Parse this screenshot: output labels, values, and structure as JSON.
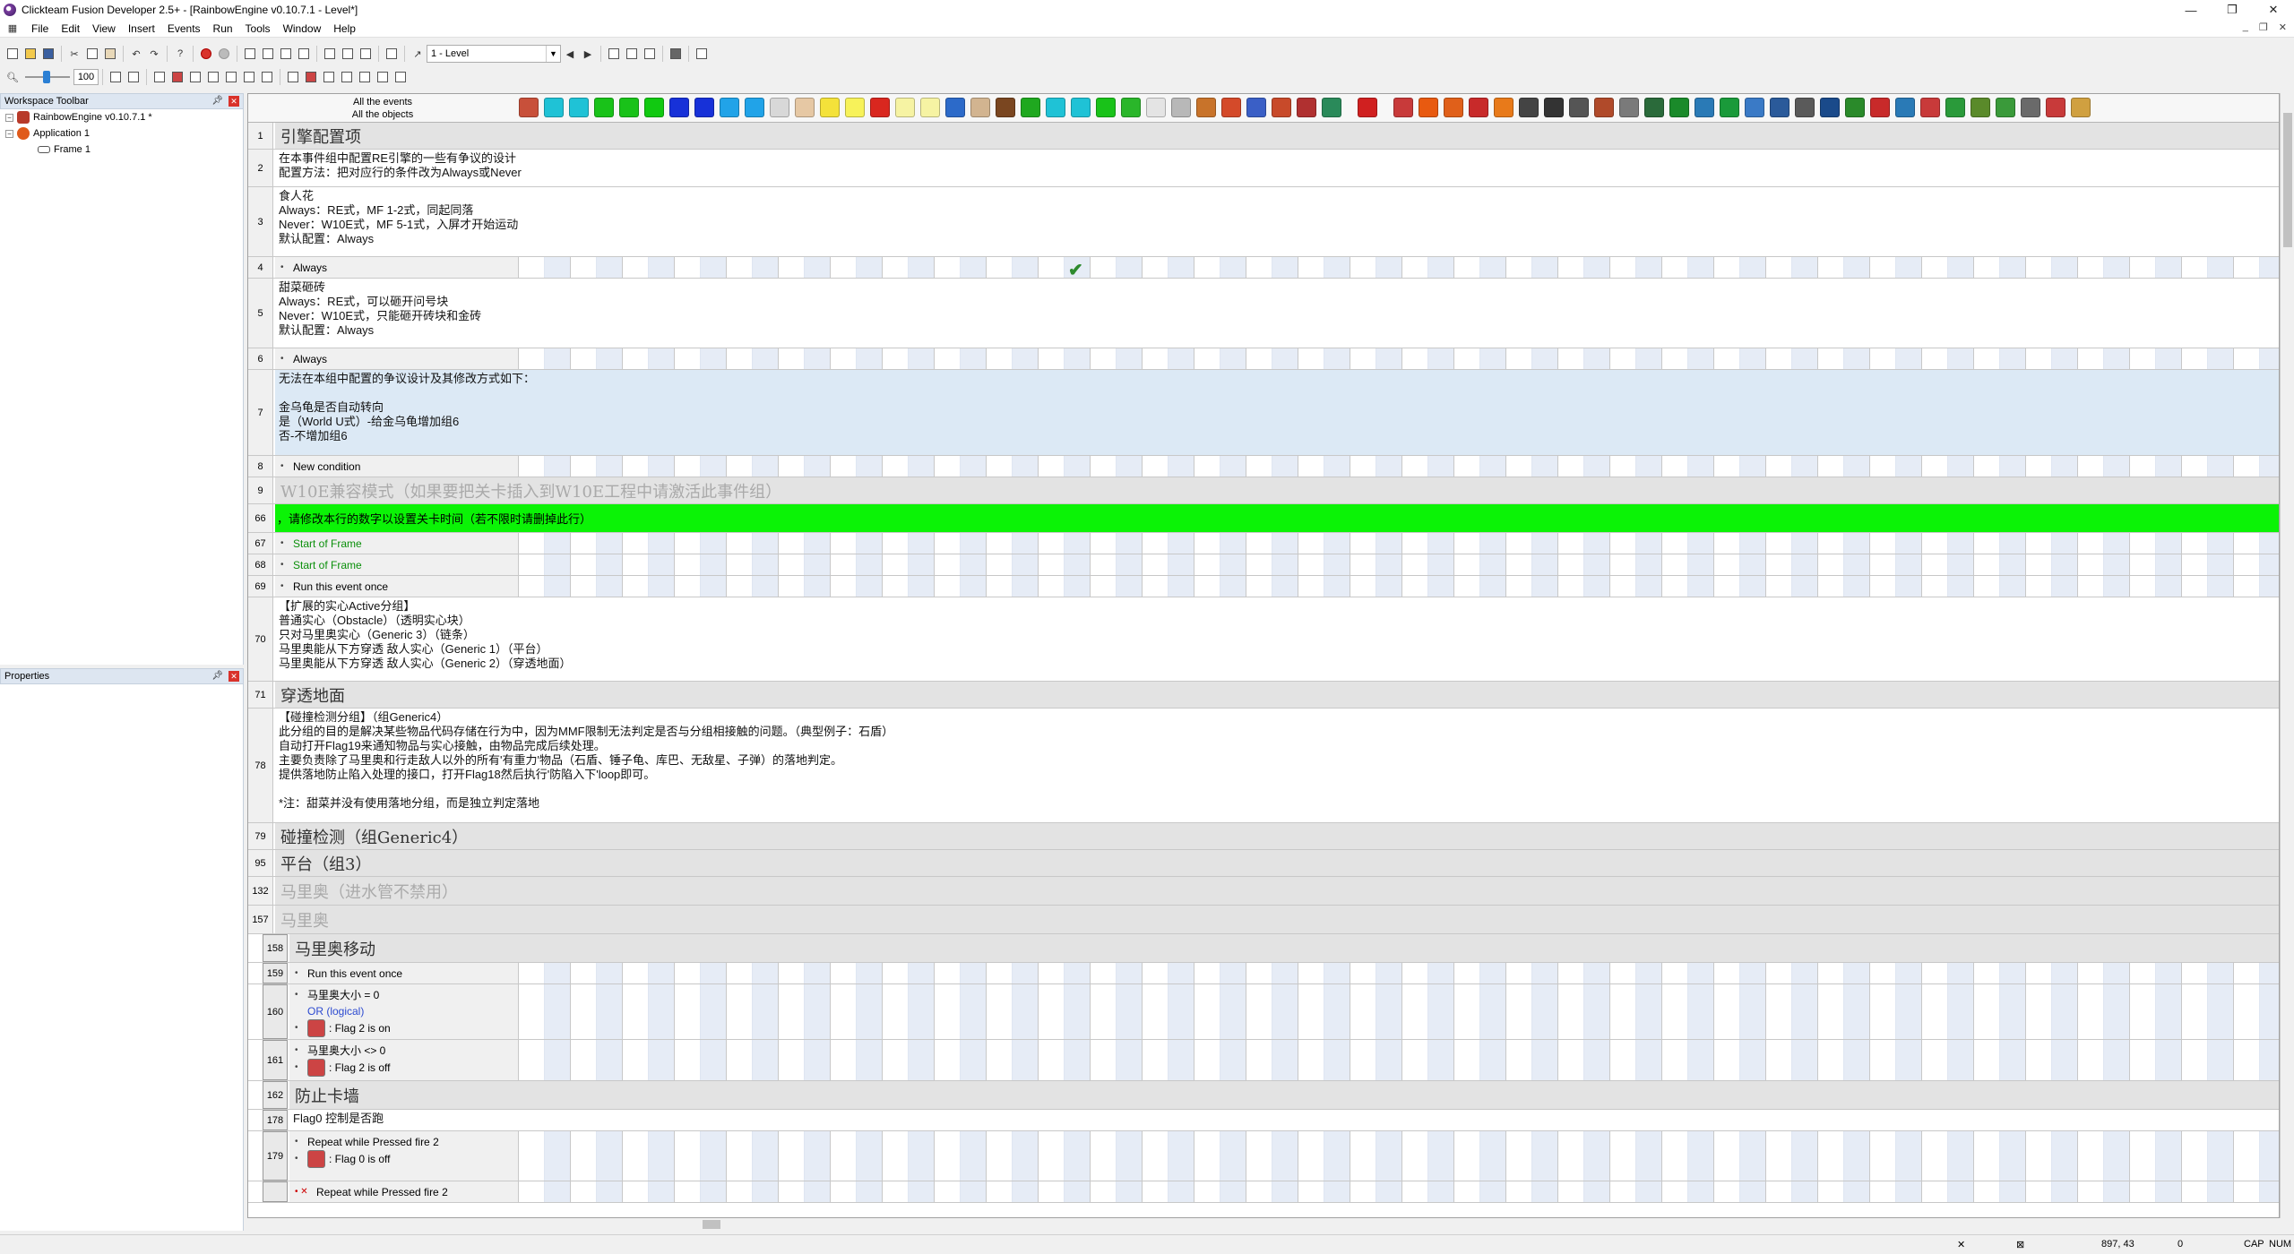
{
  "window": {
    "title": "Clickteam Fusion Developer 2.5+ - [RainbowEngine v0.10.7.1 - Level*]",
    "min": "—",
    "max": "❐",
    "close": "✕"
  },
  "menu": [
    "File",
    "Edit",
    "View",
    "Insert",
    "Events",
    "Run",
    "Tools",
    "Window",
    "Help"
  ],
  "toolbar": {
    "frame_combo": "1 - Level",
    "zoom": "100"
  },
  "workspace": {
    "title": "Workspace Toolbar",
    "tree": [
      "RainbowEngine v0.10.7.1 *",
      "Application 1",
      "Frame 1"
    ]
  },
  "properties": {
    "title": "Properties"
  },
  "editor": {
    "header_line1": "All the events",
    "header_line2": "All the objects"
  },
  "rows": [
    {
      "num": "1",
      "type": "group",
      "text": "引擎配置项",
      "h": 30
    },
    {
      "num": "2",
      "type": "comment",
      "text": "在本事件组中配置RE引擎的一些有争议的设计\n配置方法：把对应行的条件改为Always或Never",
      "h": 42
    },
    {
      "num": "3",
      "type": "comment",
      "text": "食人花\nAlways：RE式，MF 1-2式，同起同落\nNever：W10E式，MF 5-1式，入屏才开始运动\n默认配置：Always",
      "h": 78
    },
    {
      "num": "4",
      "type": "event",
      "conds": [
        {
          "text": "Always",
          "style": "plain"
        }
      ],
      "h": 24,
      "check": true
    },
    {
      "num": "5",
      "type": "comment",
      "text": "甜菜砸砖\nAlways：RE式，可以砸开问号块\nNever：W10E式，只能砸开砖块和金砖\n默认配置：Always",
      "h": 78
    },
    {
      "num": "6",
      "type": "event",
      "conds": [
        {
          "text": "Always",
          "style": "plain"
        }
      ],
      "h": 24
    },
    {
      "num": "7",
      "type": "comment",
      "blue": true,
      "text": "无法在本组中配置的争议设计及其修改方式如下：\n\n金乌龟是否自动转向\n是（World U式）-给金乌龟增加组6\n否-不增加组6",
      "h": 96
    },
    {
      "num": "8",
      "type": "event",
      "conds": [
        {
          "text": "New condition",
          "style": "plain"
        }
      ],
      "h": 24
    },
    {
      "num": "9",
      "type": "group",
      "dim": true,
      "text": "W10E兼容模式（如果要把关卡插入到W10E工程中请激活此事件组）",
      "h": 30
    },
    {
      "num": "66",
      "type": "green",
      "text": "，请修改本行的数字以设置关卡时间（若不限时请删掉此行）",
      "h": 32
    },
    {
      "num": "67",
      "type": "event",
      "conds": [
        {
          "text": "Start of Frame",
          "style": "green"
        }
      ],
      "h": 24
    },
    {
      "num": "68",
      "type": "event",
      "conds": [
        {
          "text": "Start of Frame",
          "style": "green"
        }
      ],
      "h": 24
    },
    {
      "num": "69",
      "type": "event",
      "conds": [
        {
          "text": "Run this event once",
          "style": "plain"
        }
      ],
      "h": 24
    },
    {
      "num": "70",
      "type": "comment",
      "text": "【扩展的实心Active分组】\n普通实心（Obstacle）（透明实心块）\n只对马里奥实心（Generic 3）（链条）\n马里奥能从下方穿透 敌人实心（Generic 1）（平台）\n马里奥能从下方穿透 敌人实心（Generic 2）（穿透地面）",
      "h": 94
    },
    {
      "num": "71",
      "type": "group",
      "text": "穿透地面",
      "h": 30
    },
    {
      "num": "78",
      "type": "comment",
      "text": "【碰撞检测分组】（组Generic4）\n此分组的目的是解决某些物品代码存储在行为中，因为MMF限制无法判定是否与分组相接触的问题。（典型例子：石盾）\n自动打开Flag19来通知物品与实心接触，由物品完成后续处理。\n主要负责除了马里奥和行走敌人以外的所有'有重力'物品（石盾、锤子龟、库巴、无敌星、子弹）的落地判定。\n提供落地防止陷入处理的接口，打开Flag18然后执行'防陷入下'loop即可。\n\n*注：甜菜并没有使用落地分组，而是独立判定落地",
      "h": 128
    },
    {
      "num": "79",
      "type": "group",
      "text": "碰撞检测（组Generic4）",
      "h": 30
    },
    {
      "num": "95",
      "type": "group",
      "text": "平台（组3）",
      "h": 30
    },
    {
      "num": "132",
      "type": "group",
      "dim": true,
      "text": "马里奥（进水管不禁用）",
      "h": 32
    },
    {
      "num": "157",
      "type": "group",
      "dim": true,
      "text": "马里奥",
      "h": 32
    },
    {
      "num": "158",
      "type": "group",
      "text": "马里奥移动",
      "h": 32,
      "indent": 1
    },
    {
      "num": "159",
      "type": "event",
      "indent": 1,
      "conds": [
        {
          "text": "Run this event once",
          "style": "plain"
        }
      ],
      "h": 24
    },
    {
      "num": "160",
      "type": "event",
      "indent": 1,
      "conds": [
        {
          "text": "马里奥大小 = 0",
          "style": "plain"
        },
        {
          "text": "OR (logical)",
          "style": "blue",
          "nobullet": true
        },
        {
          "text": ": Flag 2 is on",
          "style": "obj"
        }
      ],
      "h": 62
    },
    {
      "num": "161",
      "type": "event",
      "indent": 1,
      "conds": [
        {
          "text": "马里奥大小 <> 0",
          "style": "plain"
        },
        {
          "text": ": Flag 2 is off",
          "style": "obj"
        }
      ],
      "h": 46
    },
    {
      "num": "162",
      "type": "group",
      "text": "防止卡墙",
      "h": 32,
      "indent": 1
    },
    {
      "num": "178",
      "type": "comment",
      "indent": 1,
      "text": "Flag0 控制是否跑",
      "h": 24
    },
    {
      "num": "179",
      "type": "event",
      "indent": 1,
      "conds": [
        {
          "text": "Repeat while  Pressed fire 2",
          "style": "obj2"
        },
        {
          "text": ": Flag 0 is off",
          "style": "obj"
        }
      ],
      "h": 56
    },
    {
      "num": "",
      "type": "event",
      "indent": 1,
      "conds": [
        {
          "text": "Repeat while  Pressed fire 2",
          "style": "xobj"
        }
      ],
      "h": 24
    }
  ],
  "status": {
    "coords": "897, 43",
    "count": "0",
    "caps": "CAP",
    "num": "NUM"
  },
  "colors": {
    "group_bg": "#e3e3e3",
    "green_row": "#0bf306",
    "comment_blue": "#dce9f5",
    "grid_alt": "#e6ecf6"
  },
  "object_icon_colors": [
    "#c8503a",
    "#1fc2d6",
    "#1fc2d6",
    "#19c219",
    "#19c219",
    "#11c911",
    "#1731d8",
    "#1731d8",
    "#21a3e8",
    "#21a3e8",
    "#d8d8d8",
    "#e6c8a4",
    "#f4e23a",
    "#f7f25a",
    "#d9271f",
    "#f6f3a3",
    "#f6f3a3",
    "#2c6ac9",
    "#d2b490",
    "#7a4620",
    "#1fa81f",
    "#1fc2d6",
    "#1fc2d6",
    "#19c219",
    "#2ab62a",
    "#e4e4e4",
    "#b8b8b8",
    "#c8732a",
    "#d44a2a",
    "#3a5fc6",
    "#c84a2a",
    "#b03030",
    "#2a8a5a",
    "#d02020",
    "#c83a3a",
    "#e85a10",
    "#e0601a",
    "#c82a2a",
    "#e87a1a",
    "#444",
    "#333",
    "#555",
    "#b04a2a",
    "#7a7a7a",
    "#2a6a3a",
    "#1a8a2a",
    "#2a7ab6",
    "#1a9a3a",
    "#3a7ac6",
    "#2a5a9a",
    "#5a5a5a",
    "#1a4a8a",
    "#2a8a2a",
    "#c82a2a",
    "#2a7ab6",
    "#c83a3a",
    "#2a9a3a",
    "#5a8a2a",
    "#3a9a3a",
    "#6a6a6a",
    "#c83a3a",
    "#d0a040"
  ]
}
